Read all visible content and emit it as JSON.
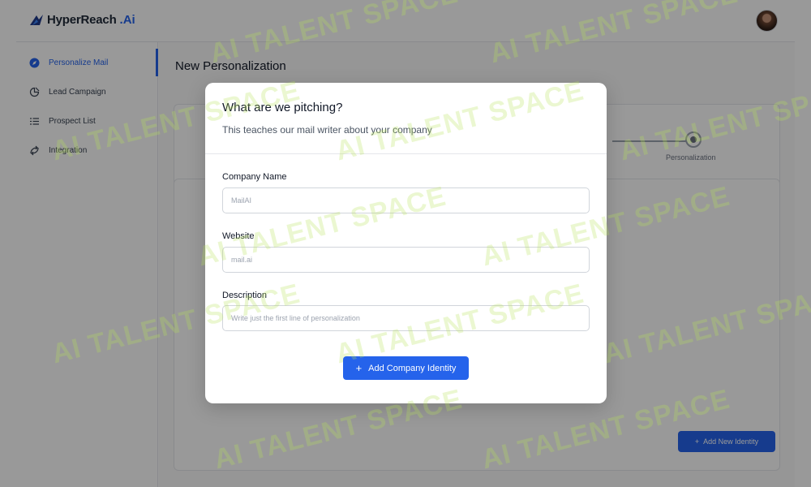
{
  "brand": {
    "name": "HyperReach",
    "suffix": ".Ai"
  },
  "sidebar": {
    "items": [
      {
        "label": "Personalize Mail",
        "icon": "compass-icon",
        "active": true
      },
      {
        "label": "Lead Campaign",
        "icon": "campaign-icon",
        "active": false
      },
      {
        "label": "Prospect List",
        "icon": "list-icon",
        "active": false
      },
      {
        "label": "Integration",
        "icon": "integration-icon",
        "active": false
      }
    ]
  },
  "main": {
    "title": "New Personalization",
    "step_label": "Personalization",
    "add_identity_label": "Add New Identity"
  },
  "modal": {
    "title": "What are we pitching?",
    "subtitle": "This teaches our mail writer about your company",
    "fields": [
      {
        "label": "Company Name",
        "placeholder": "MailAI"
      },
      {
        "label": "Website",
        "placeholder": "mail.ai"
      },
      {
        "label": "Description",
        "placeholder": "Write just the first line of personalization"
      }
    ],
    "submit_label": "Add Company Identity"
  },
  "watermark": {
    "text": "AI TALENT SPACE"
  },
  "colors": {
    "accent": "#2563eb",
    "watermark": "#b6e25a"
  }
}
